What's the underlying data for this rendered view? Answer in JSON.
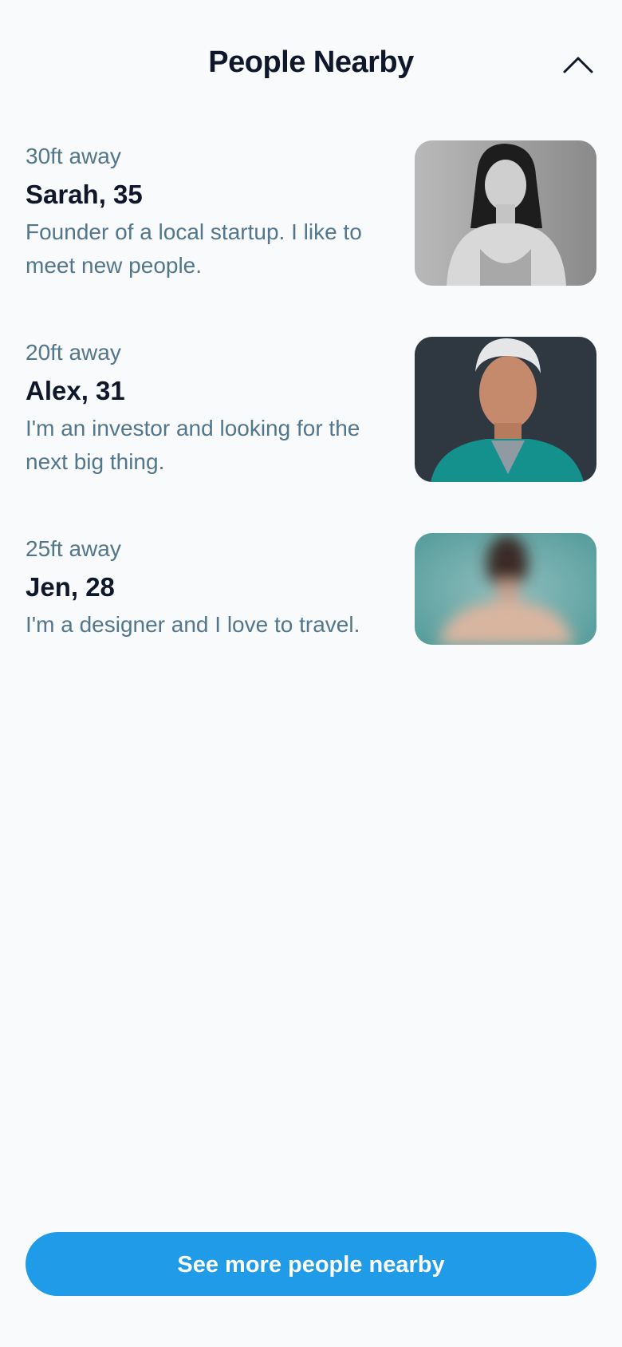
{
  "header": {
    "title": "People Nearby",
    "collapse_icon": "chevron-up-icon"
  },
  "people": [
    {
      "distance": "30ft away",
      "name": "Sarah, 35",
      "bio": "Founder of a local startup. I like to meet new people."
    },
    {
      "distance": "20ft away",
      "name": "Alex, 31",
      "bio": "I'm an investor and looking for the next big thing."
    },
    {
      "distance": "25ft away",
      "name": "Jen, 28",
      "bio": "I'm a designer and I love to travel."
    }
  ],
  "cta": {
    "label": "See more people nearby"
  },
  "colors": {
    "background": "#f8fafc",
    "accent": "#1f9be8",
    "muted_text": "#52768c",
    "primary_text": "#0f172a"
  }
}
